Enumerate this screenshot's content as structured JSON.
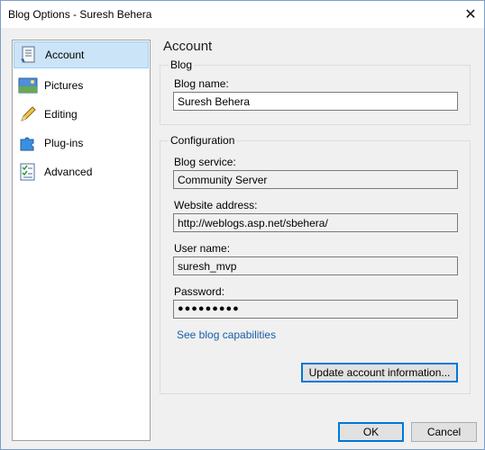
{
  "window": {
    "title": "Blog Options - Suresh Behera",
    "close_glyph": "✕"
  },
  "nav": {
    "items": [
      {
        "label": "Account",
        "icon": "account-icon",
        "selected": true
      },
      {
        "label": "Pictures",
        "icon": "pictures-icon",
        "selected": false
      },
      {
        "label": "Editing",
        "icon": "pencil-icon",
        "selected": false
      },
      {
        "label": "Plug-ins",
        "icon": "puzzle-icon",
        "selected": false
      },
      {
        "label": "Advanced",
        "icon": "checklist-icon",
        "selected": false
      }
    ]
  },
  "account": {
    "title": "Account",
    "blog_group": {
      "label": "Blog",
      "blog_name_label": "Blog name:",
      "blog_name_value": "Suresh Behera"
    },
    "config_group": {
      "label": "Configuration",
      "service_label": "Blog service:",
      "service_value": "Community Server",
      "address_label": "Website address:",
      "address_value": "http://weblogs.asp.net/sbehera/",
      "username_label": "User name:",
      "username_value": "suresh_mvp",
      "password_label": "Password:",
      "password_value": "●●●●●●●●●",
      "capabilities_link": "See blog capabilities",
      "update_button": "Update account information..."
    }
  },
  "footer": {
    "ok_label": "OK",
    "cancel_label": "Cancel"
  }
}
